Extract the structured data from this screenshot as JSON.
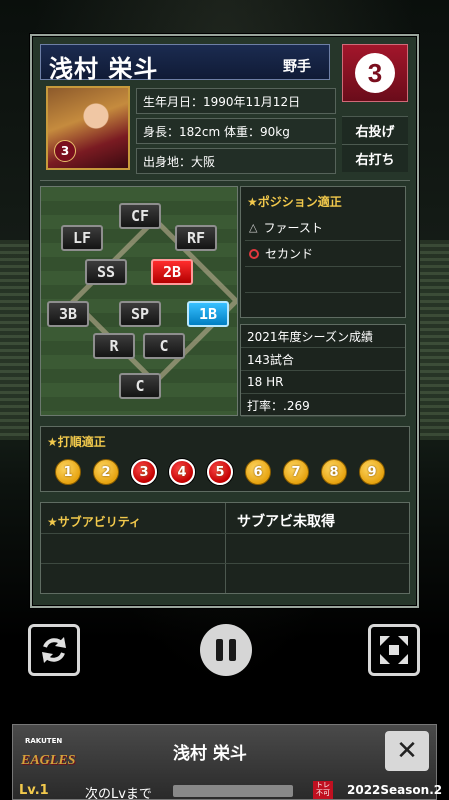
{
  "player": {
    "name": "浅村 栄斗",
    "type": "野手",
    "number": "3",
    "throws": "右投げ",
    "bats": "右打ち",
    "birthday": "生年月日：1990年11月12日",
    "body": "身長：182cm 体重：90kg",
    "birthplace": "出身地：大阪",
    "portrait_number": "3"
  },
  "field": {
    "positions": [
      {
        "label": "CF",
        "state": "normal"
      },
      {
        "label": "LF",
        "state": "normal"
      },
      {
        "label": "RF",
        "state": "normal"
      },
      {
        "label": "SS",
        "state": "normal"
      },
      {
        "label": "2B",
        "state": "main"
      },
      {
        "label": "3B",
        "state": "normal"
      },
      {
        "label": "SP",
        "state": "normal"
      },
      {
        "label": "1B",
        "state": "sub"
      },
      {
        "label": "R",
        "state": "normal"
      },
      {
        "label": "C",
        "state": "normal"
      },
      {
        "label": "C",
        "state": "normal"
      }
    ]
  },
  "position_fit": {
    "title": "★ポジション適正",
    "items": [
      {
        "mark": "triangle",
        "label": "ファースト"
      },
      {
        "mark": "circle",
        "label": "セカンド"
      }
    ]
  },
  "season": {
    "title": "2021年度シーズン成績",
    "games": "143試合",
    "hr": "18 HR",
    "avg": "打率：.269"
  },
  "batting_order": {
    "title": "★打順適正",
    "orders": [
      {
        "n": "1",
        "hot": false
      },
      {
        "n": "2",
        "hot": false
      },
      {
        "n": "3",
        "hot": true
      },
      {
        "n": "4",
        "hot": true
      },
      {
        "n": "5",
        "hot": true
      },
      {
        "n": "6",
        "hot": false
      },
      {
        "n": "7",
        "hot": false
      },
      {
        "n": "8",
        "hot": false
      },
      {
        "n": "9",
        "hot": false
      }
    ]
  },
  "sub_ability": {
    "title": "★サブアビリティ",
    "status": "サブアビ未取得"
  },
  "controls": {
    "refresh_icon": "refresh-icon",
    "pause_icon": "pause-icon",
    "expand_icon": "expand-icon"
  },
  "bottom": {
    "logo_top": "RAKUTEN",
    "logo_main": "EAGLES",
    "name": "浅村 栄斗",
    "close": "✕",
    "level": "Lv.1",
    "next_level": "次のLvまで",
    "trade_badge": "トレ不可",
    "season_tag": "2022Season.2"
  },
  "colors": {
    "accent_red": "#a3162b",
    "title_gold": "#f2c94c",
    "sub_blue": "#38c0ff"
  }
}
